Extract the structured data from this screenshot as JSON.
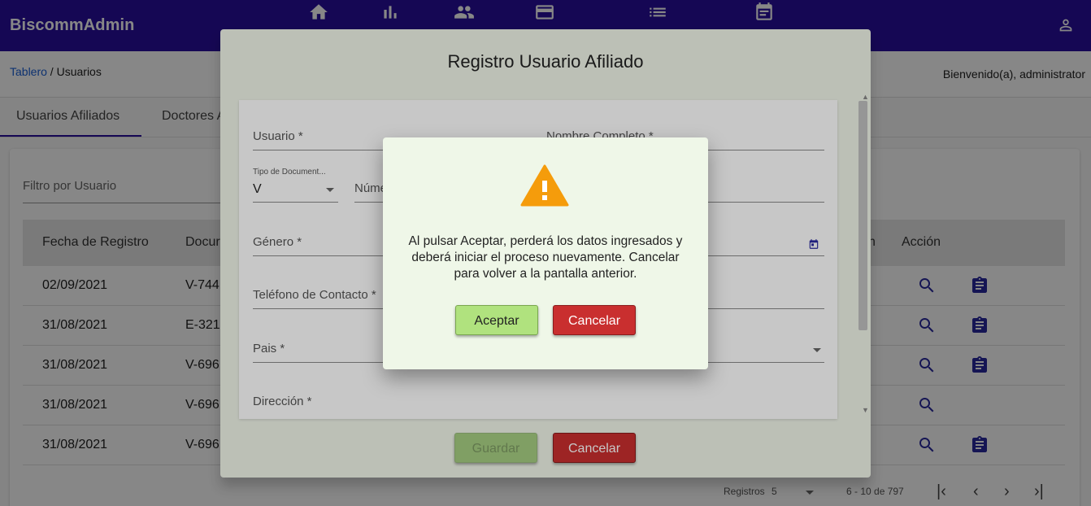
{
  "app": {
    "title": "BiscommAdmin"
  },
  "nav": {
    "icons": [
      "home-icon",
      "bar-chart-icon",
      "people-icon",
      "credit-card-icon",
      "list-icon",
      "event-note-icon"
    ],
    "user_icon": "account-icon"
  },
  "breadcrumb": {
    "link": "Tablero",
    "separator": " / ",
    "current": "Usuarios"
  },
  "welcome": "Bienvenido(a), administrator",
  "tabs": [
    {
      "label": "Usuarios Afiliados",
      "active": true
    },
    {
      "label": "Doctores A"
    }
  ],
  "filter": {
    "placeholder": "Filtro por Usuario"
  },
  "table": {
    "headers": [
      "Fecha de Registro",
      "Docur",
      "n",
      "Acción"
    ],
    "rows": [
      {
        "fecha": "02/09/2021",
        "doc": "V-744",
        "icons": [
          "search-icon",
          "assignment-icon"
        ]
      },
      {
        "fecha": "31/08/2021",
        "doc": "E-321",
        "icons": [
          "search-icon",
          "assignment-icon"
        ]
      },
      {
        "fecha": "31/08/2021",
        "doc": "V-696",
        "icons": [
          "search-icon",
          "assignment-icon"
        ]
      },
      {
        "fecha": "31/08/2021",
        "doc": "V-696",
        "icons": [
          "search-icon"
        ]
      },
      {
        "fecha": "31/08/2021",
        "doc": "V-696",
        "icons": [
          "search-icon",
          "assignment-icon"
        ]
      }
    ]
  },
  "pager": {
    "label": "Registros",
    "page_size": "5",
    "range": "6 - 10 de 797"
  },
  "form_dialog": {
    "title": "Registro Usuario Afiliado",
    "fields": {
      "usuario": "Usuario *",
      "nombre": "Nombre Completo *",
      "tipo_doc_label": "Tipo de Document...",
      "tipo_doc_value": "V",
      "numero": "Núme",
      "genero": "Género *",
      "telefono": "Teléfono de Contacto *",
      "pais": "Pais *",
      "direccion": "Dirección *"
    },
    "save_label": "Guardar",
    "cancel_label": "Cancelar"
  },
  "confirm_dialog": {
    "message": "Al pulsar Aceptar, perderá los datos ingresados y deberá iniciar el proceso nuevamente. Cancelar para volver a la pantalla anterior.",
    "accept_label": "Aceptar",
    "cancel_label": "Cancelar",
    "icon": "warning-icon",
    "icon_color": "#f59c0b"
  },
  "colors": {
    "appbar": "#2a0fa0",
    "accept": "#b0e27e",
    "cancel": "#c92f2f",
    "link": "#1a5fd6"
  }
}
